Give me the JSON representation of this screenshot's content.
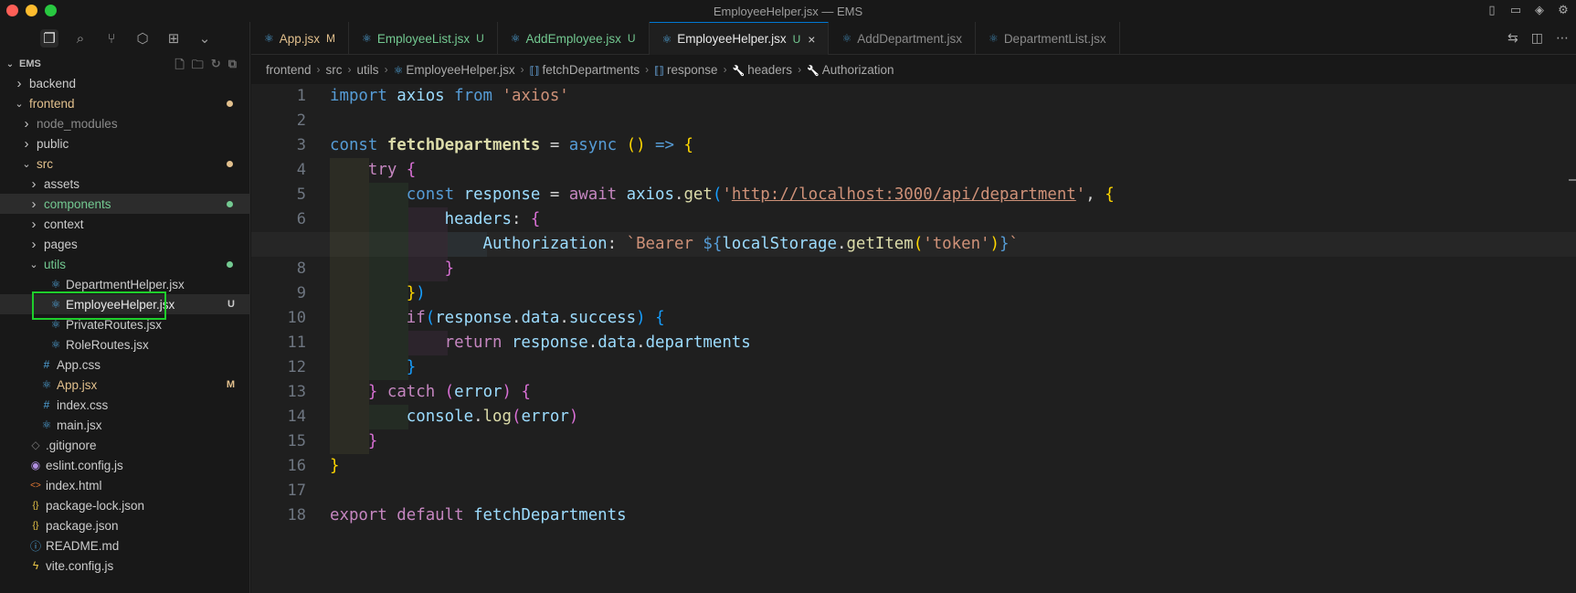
{
  "window": {
    "title": "EmployeeHelper.jsx — EMS"
  },
  "explorer": {
    "root": "EMS",
    "items": [
      {
        "label": "backend",
        "kind": "folder",
        "depth": 1,
        "open": false
      },
      {
        "label": "frontend",
        "kind": "folder",
        "depth": 1,
        "open": true,
        "status": "dot",
        "color": "#e2c08d"
      },
      {
        "label": "node_modules",
        "kind": "folder",
        "depth": 2,
        "open": false,
        "dim": true
      },
      {
        "label": "public",
        "kind": "folder",
        "depth": 2,
        "open": false
      },
      {
        "label": "src",
        "kind": "folder",
        "depth": 2,
        "open": true,
        "status": "dot",
        "color": "#e2c08d"
      },
      {
        "label": "assets",
        "kind": "folder",
        "depth": 3,
        "open": false
      },
      {
        "label": "components",
        "kind": "folder",
        "depth": 3,
        "open": false,
        "status": "dot",
        "color": "#73c991",
        "highlight": true
      },
      {
        "label": "context",
        "kind": "folder",
        "depth": 3,
        "open": false
      },
      {
        "label": "pages",
        "kind": "folder",
        "depth": 3,
        "open": false
      },
      {
        "label": "utils",
        "kind": "folder",
        "depth": 3,
        "open": true,
        "status": "dot",
        "color": "#73c991"
      },
      {
        "label": "DepartmentHelper.jsx",
        "kind": "react",
        "depth": 4
      },
      {
        "label": "EmployeeHelper.jsx",
        "kind": "react",
        "depth": 4,
        "badge": "U",
        "color": "#73c991",
        "selected": true
      },
      {
        "label": "PrivateRoutes.jsx",
        "kind": "react",
        "depth": 4
      },
      {
        "label": "RoleRoutes.jsx",
        "kind": "react",
        "depth": 4
      },
      {
        "label": "App.css",
        "kind": "css",
        "depth": 3
      },
      {
        "label": "App.jsx",
        "kind": "react",
        "depth": 3,
        "badge": "M",
        "color": "#e2c08d"
      },
      {
        "label": "index.css",
        "kind": "css",
        "depth": 3
      },
      {
        "label": "main.jsx",
        "kind": "react",
        "depth": 3
      },
      {
        "label": ".gitignore",
        "kind": "git",
        "depth": 2
      },
      {
        "label": "eslint.config.js",
        "kind": "eslint",
        "depth": 2
      },
      {
        "label": "index.html",
        "kind": "html",
        "depth": 2
      },
      {
        "label": "package-lock.json",
        "kind": "json",
        "depth": 2
      },
      {
        "label": "package.json",
        "kind": "json",
        "depth": 2
      },
      {
        "label": "README.md",
        "kind": "info",
        "depth": 2
      },
      {
        "label": "vite.config.js",
        "kind": "vite",
        "depth": 2
      }
    ]
  },
  "tabs": [
    {
      "label": "App.jsx",
      "mod": "M",
      "mod_color": "#e2c08d",
      "label_color": "#e2c08d"
    },
    {
      "label": "EmployeeList.jsx",
      "mod": "U",
      "mod_color": "#73c991",
      "label_color": "#73c991"
    },
    {
      "label": "AddEmployee.jsx",
      "mod": "U",
      "mod_color": "#73c991",
      "label_color": "#73c991"
    },
    {
      "label": "EmployeeHelper.jsx",
      "mod": "U",
      "mod_color": "#73c991",
      "label_color": "#73c991",
      "active": true
    },
    {
      "label": "AddDepartment.jsx",
      "mod": "",
      "label_color": "#8a8a8a"
    },
    {
      "label": "DepartmentList.jsx",
      "mod": "",
      "label_color": "#8a8a8a"
    }
  ],
  "breadcrumb": [
    "frontend",
    "src",
    "utils",
    "EmployeeHelper.jsx",
    "fetchDepartments",
    "response",
    "headers",
    "Authorization"
  ],
  "editor": {
    "current_line": 7,
    "lines": [
      [
        [
          "kwb",
          "import "
        ],
        [
          "var",
          "axios "
        ],
        [
          "kwb",
          "from "
        ],
        [
          "str",
          "'axios'"
        ]
      ],
      [],
      [
        [
          "kwb",
          "const "
        ],
        [
          "fnb",
          "fetchDepartments"
        ],
        [
          "plain",
          " = "
        ],
        [
          "kwb",
          "async "
        ],
        [
          "p1",
          "() "
        ],
        [
          "kwb",
          "=> "
        ],
        [
          "p1",
          "{"
        ]
      ],
      [
        [
          "plain",
          "    "
        ],
        [
          "kw",
          "try "
        ],
        [
          "p2",
          "{"
        ]
      ],
      [
        [
          "plain",
          "        "
        ],
        [
          "kwb",
          "const "
        ],
        [
          "var",
          "response "
        ],
        [
          "plain",
          "= "
        ],
        [
          "kw",
          "await "
        ],
        [
          "var",
          "axios"
        ],
        [
          "plain",
          "."
        ],
        [
          "fn",
          "get"
        ],
        [
          "p3",
          "("
        ],
        [
          "str",
          "'"
        ],
        [
          "url",
          "http://localhost:3000/api/department"
        ],
        [
          "str",
          "'"
        ],
        [
          "plain",
          ", "
        ],
        [
          "p1",
          "{"
        ]
      ],
      [
        [
          "plain",
          "            "
        ],
        [
          "var",
          "headers"
        ],
        [
          "plain",
          ": "
        ],
        [
          "p2",
          "{"
        ]
      ],
      [
        [
          "plain",
          "                "
        ],
        [
          "var",
          "Authorization"
        ],
        [
          "plain",
          ": "
        ],
        [
          "str",
          "`Bearer "
        ],
        [
          "kwb",
          "${"
        ],
        [
          "var",
          "localStorage"
        ],
        [
          "plain",
          "."
        ],
        [
          "fn",
          "getItem"
        ],
        [
          "p1",
          "("
        ],
        [
          "str",
          "'token'"
        ],
        [
          "p1",
          ")"
        ],
        [
          "kwb",
          "}"
        ],
        [
          "str",
          "`"
        ]
      ],
      [
        [
          "plain",
          "            "
        ],
        [
          "p2",
          "}"
        ]
      ],
      [
        [
          "plain",
          "        "
        ],
        [
          "p1",
          "}"
        ],
        [
          "p3",
          ")"
        ]
      ],
      [
        [
          "plain",
          "        "
        ],
        [
          "kw",
          "if"
        ],
        [
          "p3",
          "("
        ],
        [
          "var",
          "response"
        ],
        [
          "plain",
          "."
        ],
        [
          "var",
          "data"
        ],
        [
          "plain",
          "."
        ],
        [
          "var",
          "success"
        ],
        [
          "p3",
          ") "
        ],
        [
          "p3",
          "{"
        ]
      ],
      [
        [
          "plain",
          "            "
        ],
        [
          "kw",
          "return "
        ],
        [
          "var",
          "response"
        ],
        [
          "plain",
          "."
        ],
        [
          "var",
          "data"
        ],
        [
          "plain",
          "."
        ],
        [
          "var",
          "departments"
        ]
      ],
      [
        [
          "plain",
          "        "
        ],
        [
          "p3",
          "}"
        ]
      ],
      [
        [
          "plain",
          "    "
        ],
        [
          "p2",
          "} "
        ],
        [
          "kw",
          "catch "
        ],
        [
          "p2",
          "("
        ],
        [
          "var",
          "error"
        ],
        [
          "p2",
          ") "
        ],
        [
          "p2",
          "{"
        ]
      ],
      [
        [
          "plain",
          "        "
        ],
        [
          "var",
          "console"
        ],
        [
          "plain",
          "."
        ],
        [
          "fn",
          "log"
        ],
        [
          "p2",
          "("
        ],
        [
          "var",
          "error"
        ],
        [
          "p2",
          ")"
        ]
      ],
      [
        [
          "plain",
          "    "
        ],
        [
          "p2",
          "}"
        ]
      ],
      [
        [
          "p1",
          "}"
        ]
      ],
      [],
      [
        [
          "kw",
          "export "
        ],
        [
          "kw",
          "default "
        ],
        [
          "var",
          "fetchDepartments"
        ]
      ]
    ],
    "indent_guides": [
      [],
      [],
      [],
      [
        1
      ],
      [
        1,
        2
      ],
      [
        1,
        2,
        3
      ],
      [
        1,
        2,
        3,
        4
      ],
      [
        1,
        2,
        3
      ],
      [
        1,
        2
      ],
      [
        1,
        2
      ],
      [
        1,
        2,
        3
      ],
      [
        1,
        2
      ],
      [
        1
      ],
      [
        1,
        2
      ],
      [
        1
      ],
      [],
      [],
      []
    ]
  }
}
